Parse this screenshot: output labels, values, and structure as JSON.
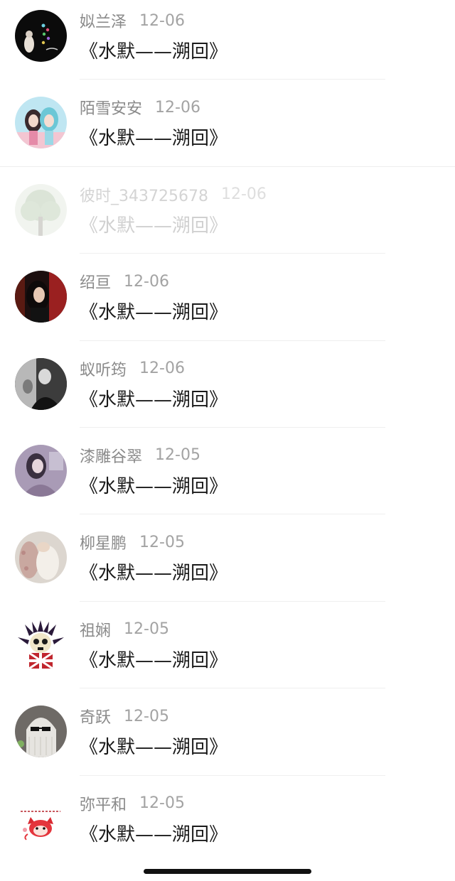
{
  "comments": [
    {
      "name": "姒兰泽",
      "date": "12-06",
      "text": "《水默——溯回》",
      "avatar_icon": "avatar-dark-welcome-icon",
      "faded": false
    },
    {
      "name": "陌雪安安",
      "date": "12-06",
      "text": "《水默——溯回》",
      "avatar_icon": "avatar-anime-girls-icon",
      "faded": false
    },
    {
      "name": "彼时_343725678",
      "date": "12-06",
      "text": "《水默——溯回》",
      "avatar_icon": "avatar-tree-icon",
      "faded": true
    },
    {
      "name": "绍亘",
      "date": "12-06",
      "text": "《水默——溯回》",
      "avatar_icon": "avatar-dark-portrait-icon",
      "faded": false
    },
    {
      "name": "蚁听筠",
      "date": "12-06",
      "text": "《水默——溯回》",
      "avatar_icon": "avatar-bw-portrait-icon",
      "faded": false
    },
    {
      "name": "漆雕谷翠",
      "date": "12-05",
      "text": "《水默——溯回》",
      "avatar_icon": "avatar-lavender-girl-icon",
      "faded": false
    },
    {
      "name": "柳星鹏",
      "date": "12-05",
      "text": "《水默——溯回》",
      "avatar_icon": "avatar-pale-hands-icon",
      "faded": false
    },
    {
      "name": "祖娴",
      "date": "12-05",
      "text": "《水默——溯回》",
      "avatar_icon": "avatar-spiky-skull-icon",
      "faded": false
    },
    {
      "name": "奇跃",
      "date": "12-05",
      "text": "《水默——溯回》",
      "avatar_icon": "avatar-sunglasses-ghost-icon",
      "faded": false
    },
    {
      "name": "弥平和",
      "date": "12-05",
      "text": "《水默——溯回》",
      "avatar_icon": "avatar-red-cat-cartoon-icon",
      "faded": false
    }
  ],
  "colors": {
    "name": "#8a8a8a",
    "date": "#a3a3a3",
    "title": "#1a1a1a",
    "divider": "#efefef"
  }
}
